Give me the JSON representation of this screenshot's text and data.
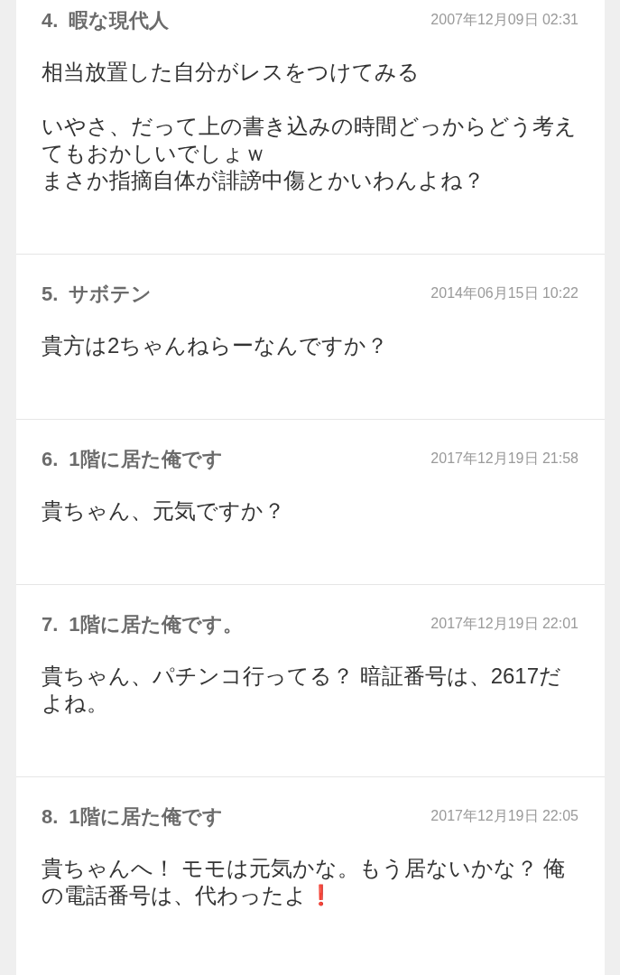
{
  "posts": [
    {
      "number": "4.",
      "name": "暇な現代人",
      "date": "2007年12月09日 02:31",
      "paragraphs": [
        [
          "相当放置した自分がレスをつけてみる"
        ],
        [
          "いやさ、だって上の書き込みの時間どっからどう考え",
          "てもおかしいでしょｗ",
          "まさか指摘自体が誹謗中傷とかいわんよね？"
        ]
      ]
    },
    {
      "number": "5.",
      "name": "サボテン",
      "date": "2014年06月15日 10:22",
      "paragraphs": [
        [
          "貴方は2ちゃんねらーなんですか？"
        ]
      ]
    },
    {
      "number": "6.",
      "name": "1階に居た俺です",
      "date": "2017年12月19日 21:58",
      "paragraphs": [
        [
          "貴ちゃん、元気ですか？"
        ]
      ]
    },
    {
      "number": "7.",
      "name": "1階に居た俺です。",
      "date": "2017年12月19日 22:01",
      "paragraphs": [
        [
          "貴ちゃん、パチンコ行ってる？ 暗証番号は、2617だ",
          "よね。"
        ]
      ]
    },
    {
      "number": "8.",
      "name": "1階に居た俺です",
      "date": "2017年12月19日 22:05",
      "paragraphs": [
        [
          "貴ちゃんへ！ モモは元気かな。もう居ないかな？ 俺",
          "の電話番号は、代わったよ"
        ]
      ],
      "end_mark": "❗"
    }
  ]
}
